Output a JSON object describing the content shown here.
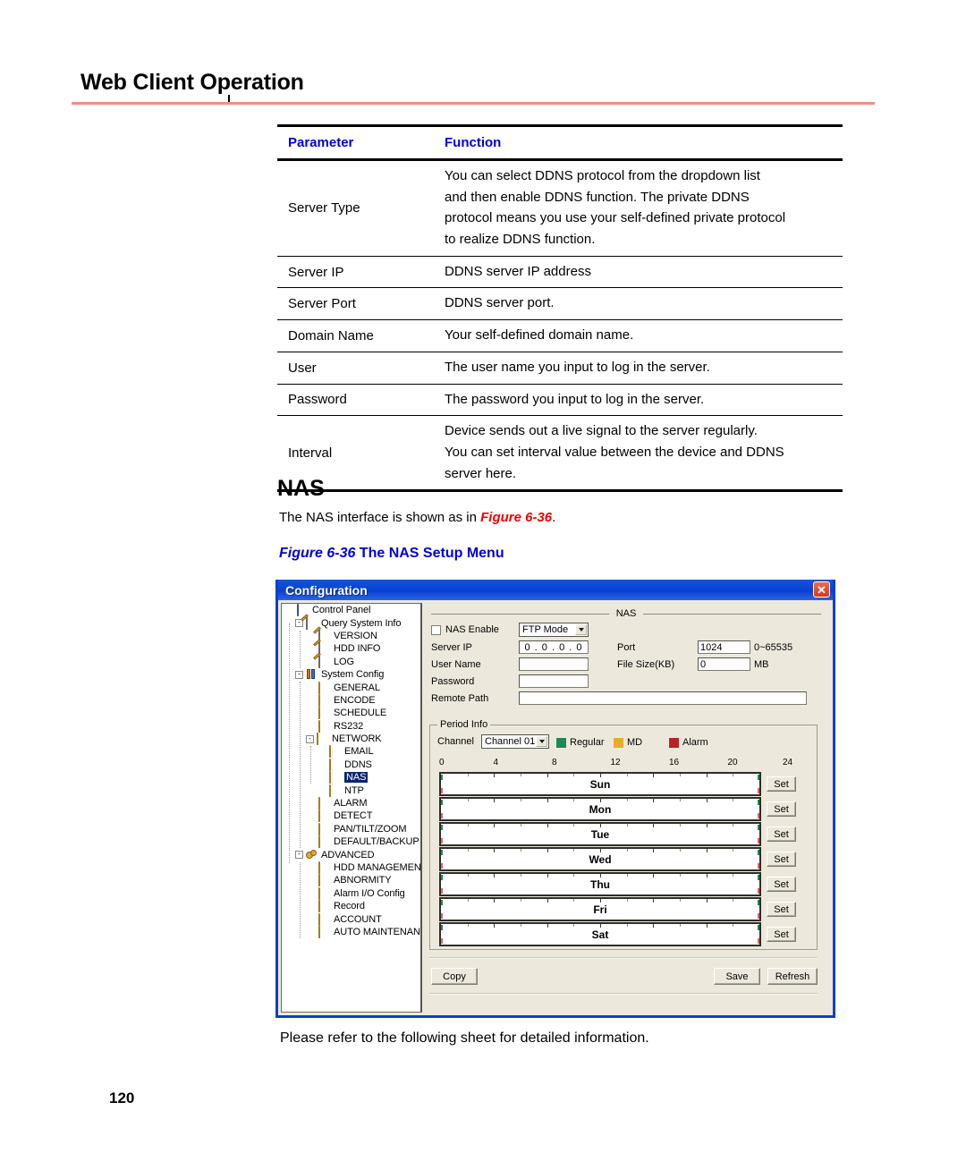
{
  "document": {
    "header_title": "Web Client Operation",
    "page_number": "120",
    "footer_note": "Please refer to the following sheet for detailed information.",
    "rule_color": "#f98a84"
  },
  "param_table": {
    "headers": [
      "Parameter",
      "Function"
    ],
    "header_color": "#0000dd",
    "rows": [
      {
        "parameter": "Server Type",
        "function_lines": [
          "You can select DDNS protocol from the dropdown list",
          "and then enable DDNS function. The private DDNS",
          "protocol means you use your self-defined private protocol",
          "to realize DDNS function."
        ]
      },
      {
        "parameter": "Server IP",
        "function_lines": [
          "DDNS server IP address"
        ]
      },
      {
        "parameter": "Server Port",
        "function_lines": [
          "DDNS server port."
        ]
      },
      {
        "parameter": "Domain Name",
        "function_lines": [
          "Your self-defined domain name."
        ]
      },
      {
        "parameter": "User",
        "function_lines": [
          "The user name you input to log in the server."
        ]
      },
      {
        "parameter": "Password",
        "function_lines": [
          "The password you input to log in the server."
        ]
      },
      {
        "parameter": "Interval",
        "function_lines": [
          "Device sends out a live signal to the server regularly.",
          "You can set interval value between the device and DDNS",
          "server here."
        ]
      }
    ]
  },
  "nas_section": {
    "heading": "NAS",
    "intro_before": "The NAS interface is shown as in ",
    "intro_figure": "Figure 6-36",
    "intro_after": ".",
    "figure_caption_num": "Figure 6-36",
    "figure_caption_text": " The NAS Setup Menu",
    "caption_color": "#0000dd"
  },
  "window": {
    "title": "Configuration",
    "close_icon": "close-icon",
    "titlebar_color": "#0a3fd4",
    "panel_color": "#ece9dc",
    "tree": [
      {
        "label": "Control Panel",
        "depth": 0,
        "icon": "monitor-icon",
        "expander": "",
        "selected": false
      },
      {
        "label": "Query System Info",
        "depth": 1,
        "icon": "note-icon",
        "expander": "-",
        "selected": false
      },
      {
        "label": "VERSION",
        "depth": 2,
        "icon": "note-icon",
        "expander": "",
        "selected": false
      },
      {
        "label": "HDD INFO",
        "depth": 2,
        "icon": "note-icon",
        "expander": "",
        "selected": false
      },
      {
        "label": "LOG",
        "depth": 2,
        "icon": "note-icon",
        "expander": "",
        "selected": false
      },
      {
        "label": "System Config",
        "depth": 1,
        "icon": "tools-icon",
        "expander": "-",
        "selected": false
      },
      {
        "label": "GENERAL",
        "depth": 2,
        "icon": "folder-icon",
        "expander": "",
        "selected": false
      },
      {
        "label": "ENCODE",
        "depth": 2,
        "icon": "folder-icon",
        "expander": "",
        "selected": false
      },
      {
        "label": "SCHEDULE",
        "depth": 2,
        "icon": "folder-icon",
        "expander": "",
        "selected": false
      },
      {
        "label": "RS232",
        "depth": 2,
        "icon": "folder-icon",
        "expander": "",
        "selected": false
      },
      {
        "label": "NETWORK",
        "depth": 2,
        "icon": "folder-icon",
        "expander": "-",
        "selected": false
      },
      {
        "label": "EMAIL",
        "depth": 3,
        "icon": "folder-icon",
        "expander": "",
        "selected": false
      },
      {
        "label": "DDNS",
        "depth": 3,
        "icon": "folder-icon",
        "expander": "",
        "selected": false
      },
      {
        "label": "NAS",
        "depth": 3,
        "icon": "folder-open-icon",
        "expander": "",
        "selected": true
      },
      {
        "label": "NTP",
        "depth": 3,
        "icon": "folder-icon",
        "expander": "",
        "selected": false
      },
      {
        "label": "ALARM",
        "depth": 2,
        "icon": "folder-icon",
        "expander": "",
        "selected": false
      },
      {
        "label": "DETECT",
        "depth": 2,
        "icon": "folder-icon",
        "expander": "",
        "selected": false
      },
      {
        "label": "PAN/TILT/ZOOM",
        "depth": 2,
        "icon": "folder-icon",
        "expander": "",
        "selected": false
      },
      {
        "label": "DEFAULT/BACKUP",
        "depth": 2,
        "icon": "folder-icon",
        "expander": "",
        "selected": false
      },
      {
        "label": "ADVANCED",
        "depth": 1,
        "icon": "gears-icon",
        "expander": "-",
        "selected": false
      },
      {
        "label": "HDD MANAGEMENT",
        "depth": 2,
        "icon": "folder-icon",
        "expander": "",
        "selected": false
      },
      {
        "label": "ABNORMITY",
        "depth": 2,
        "icon": "folder-icon",
        "expander": "",
        "selected": false
      },
      {
        "label": "Alarm I/O Config",
        "depth": 2,
        "icon": "folder-icon",
        "expander": "",
        "selected": false
      },
      {
        "label": "Record",
        "depth": 2,
        "icon": "folder-icon",
        "expander": "",
        "selected": false
      },
      {
        "label": "ACCOUNT",
        "depth": 2,
        "icon": "folder-icon",
        "expander": "",
        "selected": false
      },
      {
        "label": "AUTO MAINTENANCE",
        "depth": 2,
        "icon": "folder-icon",
        "expander": "",
        "selected": false
      }
    ],
    "panel": {
      "section_title": "NAS",
      "nas_enable_label": "NAS Enable",
      "nas_enable_checked": false,
      "mode_value": "FTP Mode",
      "server_ip_label": "Server IP",
      "server_ip_value": "0 . 0 . 0 . 0",
      "user_name_label": "User Name",
      "user_name_value": "",
      "password_label": "Password",
      "password_value": "",
      "remote_path_label": "Remote Path",
      "remote_path_value": "",
      "port_label": "Port",
      "port_value": "1024",
      "port_range": "0~65535",
      "file_size_label": "File Size(KB)",
      "file_size_value": "0",
      "file_size_unit": "MB"
    },
    "period_info": {
      "group_label": "Period Info",
      "channel_label": "Channel",
      "channel_value": "Channel 01",
      "legend": [
        {
          "label": "Regular",
          "color": "#1c8a56"
        },
        {
          "label": "MD",
          "color": "#e8ac26"
        },
        {
          "label": "Alarm",
          "color": "#bb2222"
        }
      ],
      "axis_ticks": [
        "0",
        "4",
        "8",
        "12",
        "16",
        "20",
        "24"
      ],
      "days": [
        {
          "label": "Sun",
          "set_label": "Set"
        },
        {
          "label": "Mon",
          "set_label": "Set"
        },
        {
          "label": "Tue",
          "set_label": "Set"
        },
        {
          "label": "Wed",
          "set_label": "Set"
        },
        {
          "label": "Thu",
          "set_label": "Set"
        },
        {
          "label": "Fri",
          "set_label": "Set"
        },
        {
          "label": "Sat",
          "set_label": "Set"
        }
      ]
    },
    "buttons": {
      "copy": "Copy",
      "save": "Save",
      "refresh": "Refresh"
    }
  }
}
